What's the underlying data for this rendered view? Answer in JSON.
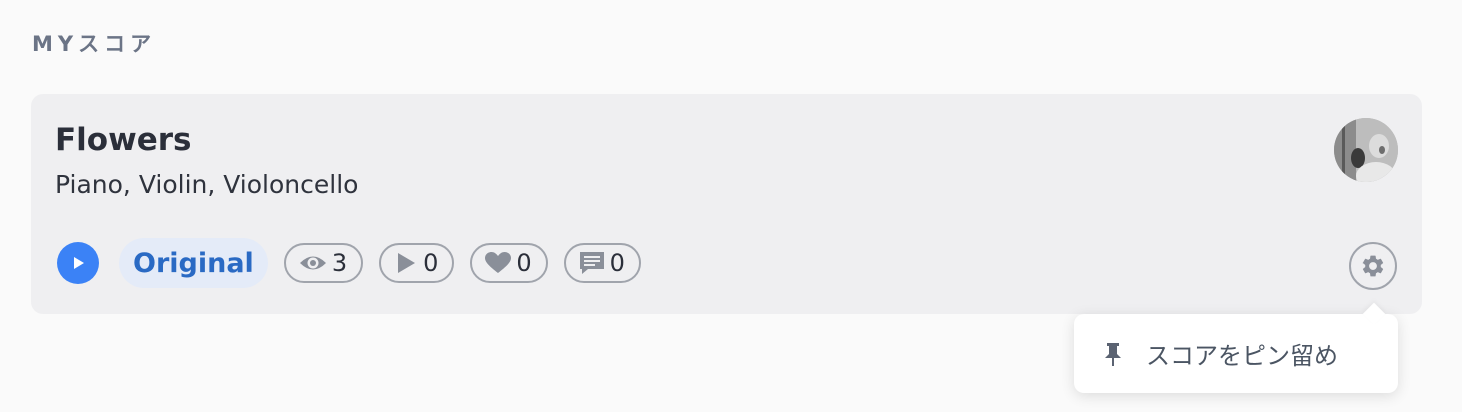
{
  "section": {
    "title": "MYスコア"
  },
  "score": {
    "title": "Flowers",
    "instruments": "Piano, Violin, Violoncello",
    "tag": "Original",
    "stats": {
      "views": "3",
      "plays": "0",
      "likes": "0",
      "comments": "0"
    }
  },
  "menu": {
    "pin_label": "スコアをピン留め"
  },
  "icons": [
    "play-icon",
    "eye-icon",
    "play-count-icon",
    "heart-icon",
    "comment-icon",
    "gear-icon",
    "pin-icon"
  ],
  "colors": {
    "accent": "#3b82f6",
    "tag_text": "#2a6ac4",
    "tag_bg": "#e4ebf8",
    "card_bg": "#efeff1"
  }
}
